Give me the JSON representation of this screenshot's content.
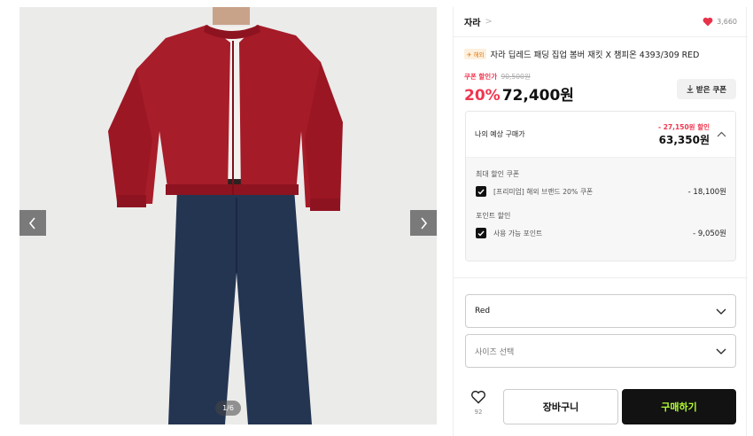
{
  "gallery": {
    "image_alt": "red bomber jacket, white knit, dark denim wide jeans",
    "counter": "1/6",
    "prev_icon": "chevron-left-icon",
    "next_icon": "chevron-right-icon"
  },
  "product": {
    "brand": "자라",
    "brand_chevron": ">",
    "like_count": "3,660",
    "overseas_badge": "해외",
    "title": "자라 딥레드 패딩 집업 봄버 재킷 X 챔피온 4393/309 RED",
    "coupon_tag": "쿠폰 할인가",
    "original_price": "90,500원",
    "discount_rate": "20%",
    "price": "72,400원",
    "coupon_button": "받은 쿠폰"
  },
  "estimate": {
    "label": "나의 예상 구매가",
    "savings": "- 27,150원 할인",
    "price": "63,350원",
    "groups": [
      {
        "title": "최대 할인 쿠폰",
        "item_label": "[프리미엄] 해외 브랜드 20% 쿠폰",
        "amount": "- 18,100원"
      },
      {
        "title": "포인트 할인",
        "item_label": "사용 가능 포인트",
        "amount": "- 9,050원"
      }
    ]
  },
  "options": {
    "color_value": "Red",
    "size_placeholder": "사이즈 선택"
  },
  "actions": {
    "wish_count": "92",
    "cart_label": "장바구니",
    "buy_label": "구매하기"
  },
  "colors": {
    "accent_red": "#f0364f",
    "buy_bg": "#121212",
    "buy_text": "#b3ff31",
    "heart": "#e8324a"
  }
}
